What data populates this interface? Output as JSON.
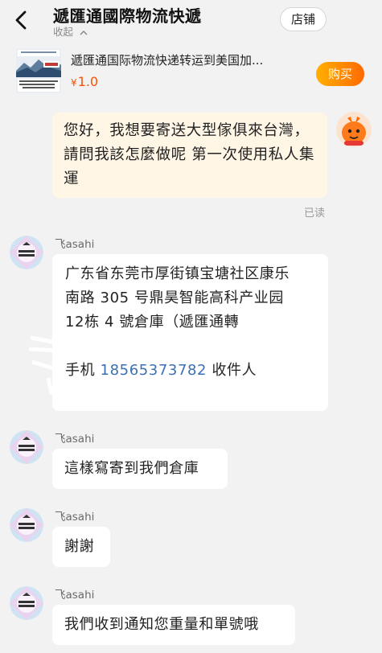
{
  "header": {
    "title": "遞匯通國際物流快遞",
    "collapse_label": "收起",
    "store_button": "店铺"
  },
  "product": {
    "title": "遞匯通国际物流快递转运到美国加...",
    "price_symbol": "¥",
    "price": "1.0",
    "buy_button": "购买"
  },
  "messages": {
    "outgoing": {
      "text": "您好，我想要寄送大型傢俱來台灣，請問我該怎麼做呢 第一次使用私人集運",
      "status": "已读"
    },
    "incoming": [
      {
        "sender": "飞asahi",
        "address_lines": [
          "广东省东莞市厚街镇宝塘社区康乐",
          "南路 305 号鼎昊智能高科产业园",
          "12栋 4 號倉庫（遞匯通轉"
        ],
        "phone_label": "手机",
        "phone": "18565373782",
        "recipient_label": "收件人"
      },
      {
        "sender": "飞asahi",
        "text": "這樣寫寄到我們倉庫"
      },
      {
        "sender": "飞asahi",
        "text": "謝謝"
      },
      {
        "sender": "飞asahi",
        "text": "我們收到通知您重量和單號哦"
      }
    ]
  },
  "colors": {
    "accent": "#ff5000",
    "buy_gradient_start": "#ffb000",
    "buy_gradient_end": "#ff6a00",
    "outgoing_bubble": "#fff6e6",
    "phone_link": "#3b6fb6"
  },
  "icons": [
    "back-chevron-icon",
    "collapse-chevron-up-icon",
    "vendor-avatar",
    "user-avatar"
  ]
}
